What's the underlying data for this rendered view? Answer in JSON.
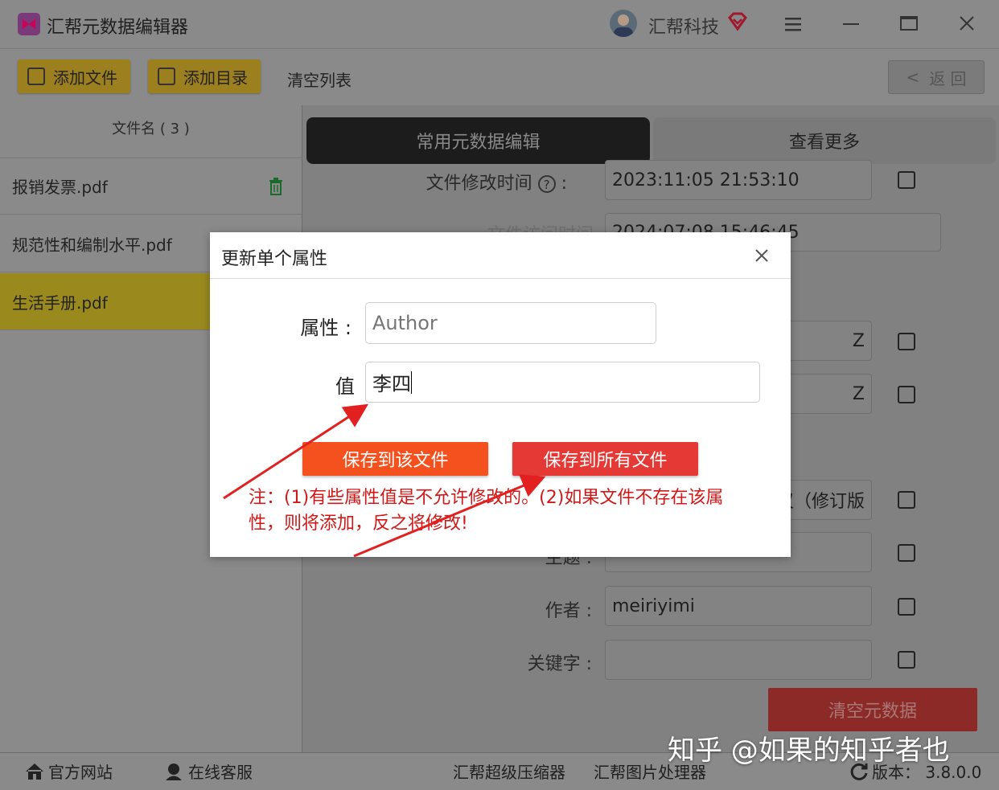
{
  "window": {
    "title": "汇帮元数据编辑器",
    "brand": "汇帮科技"
  },
  "toolbar": {
    "add_file": "添加文件",
    "add_dir": "添加目录",
    "clear_list": "清空列表",
    "back": "返 回"
  },
  "sidebar": {
    "header": "文件名 ( 3 )",
    "files": [
      {
        "name": "报销发票.pdf"
      },
      {
        "name": "规范性和编制水平.pdf"
      },
      {
        "name": "生活手册.pdf"
      }
    ]
  },
  "main": {
    "tab_common": "常用元数据编辑",
    "tab_more": "查看更多",
    "fields": {
      "mtime_label": "文件修改时间",
      "mtime_value": "2023:11:05 21:53:10",
      "atime_label": "文件访问时间",
      "atime_value": "2024:07:08 15:46:45",
      "f3_value": "Z",
      "f4_value": "Z",
      "f5_value": "议（修订版",
      "subject_label": "主题 :",
      "author_label": "作者 :",
      "author_value": "meiriyimi",
      "keywords_label": "关键字 :",
      "keywords_value": ""
    },
    "clear_meta": "清空元数据"
  },
  "dialog": {
    "title": "更新单个属性",
    "attr_label": "属性 :",
    "attr_placeholder": "Author",
    "value_label": "值",
    "value": "李四",
    "save_this": "保存到该文件",
    "save_all": "保存到所有文件",
    "note_line1": "注：(1)有些属性值是不允许修改的。(2)如果文件不存在该属",
    "note_line2": "性，则将添加，反之将修改!"
  },
  "statusbar": {
    "website": "官方网站",
    "support": "在线客服",
    "compressor": "汇帮超级压缩器",
    "image_tool": "汇帮图片处理器",
    "version": "版本：  3.8.0.0"
  },
  "watermark": "知乎 @如果的知乎者也",
  "colors": {
    "accent_yellow": "#f1c232",
    "selected_file": "#c8b42a",
    "dark_tab": "#202020",
    "btn_orange": "#f4511e",
    "btn_red": "#e53935",
    "note_red": "#d01818"
  }
}
